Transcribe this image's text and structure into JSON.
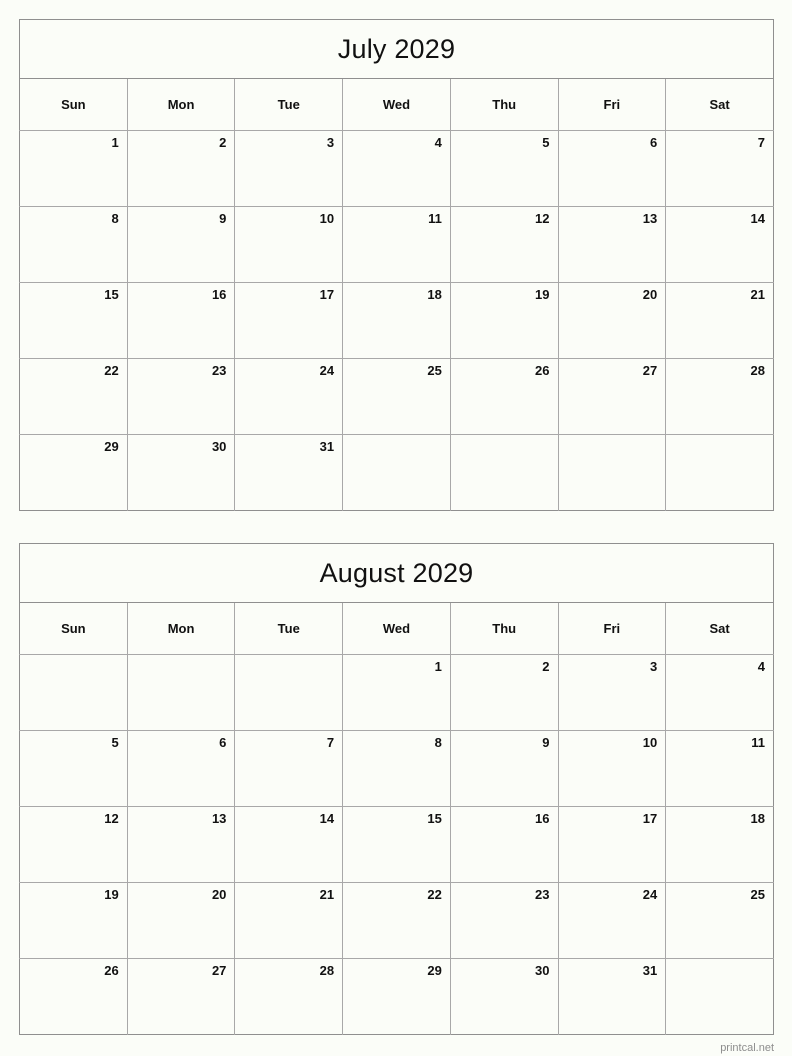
{
  "page": {
    "background_color": "#fbfdf8",
    "border_color": "#8f8f8f",
    "grid_color": "#a8a8a8",
    "text_color": "#111111"
  },
  "watermark": {
    "text": "printcal.net",
    "color": "#8d8d8d"
  },
  "weekday_headers": [
    "Sun",
    "Mon",
    "Tue",
    "Wed",
    "Thu",
    "Fri",
    "Sat"
  ],
  "months": [
    {
      "title": "July 2029",
      "name": "July",
      "year": "2029",
      "weeks": [
        [
          "1",
          "2",
          "3",
          "4",
          "5",
          "6",
          "7"
        ],
        [
          "8",
          "9",
          "10",
          "11",
          "12",
          "13",
          "14"
        ],
        [
          "15",
          "16",
          "17",
          "18",
          "19",
          "20",
          "21"
        ],
        [
          "22",
          "23",
          "24",
          "25",
          "26",
          "27",
          "28"
        ],
        [
          "29",
          "30",
          "31",
          "",
          "",
          "",
          ""
        ]
      ]
    },
    {
      "title": "August 2029",
      "name": "August",
      "year": "2029",
      "weeks": [
        [
          "",
          "",
          "",
          "1",
          "2",
          "3",
          "4"
        ],
        [
          "5",
          "6",
          "7",
          "8",
          "9",
          "10",
          "11"
        ],
        [
          "12",
          "13",
          "14",
          "15",
          "16",
          "17",
          "18"
        ],
        [
          "19",
          "20",
          "21",
          "22",
          "23",
          "24",
          "25"
        ],
        [
          "26",
          "27",
          "28",
          "29",
          "30",
          "31",
          ""
        ]
      ]
    }
  ]
}
